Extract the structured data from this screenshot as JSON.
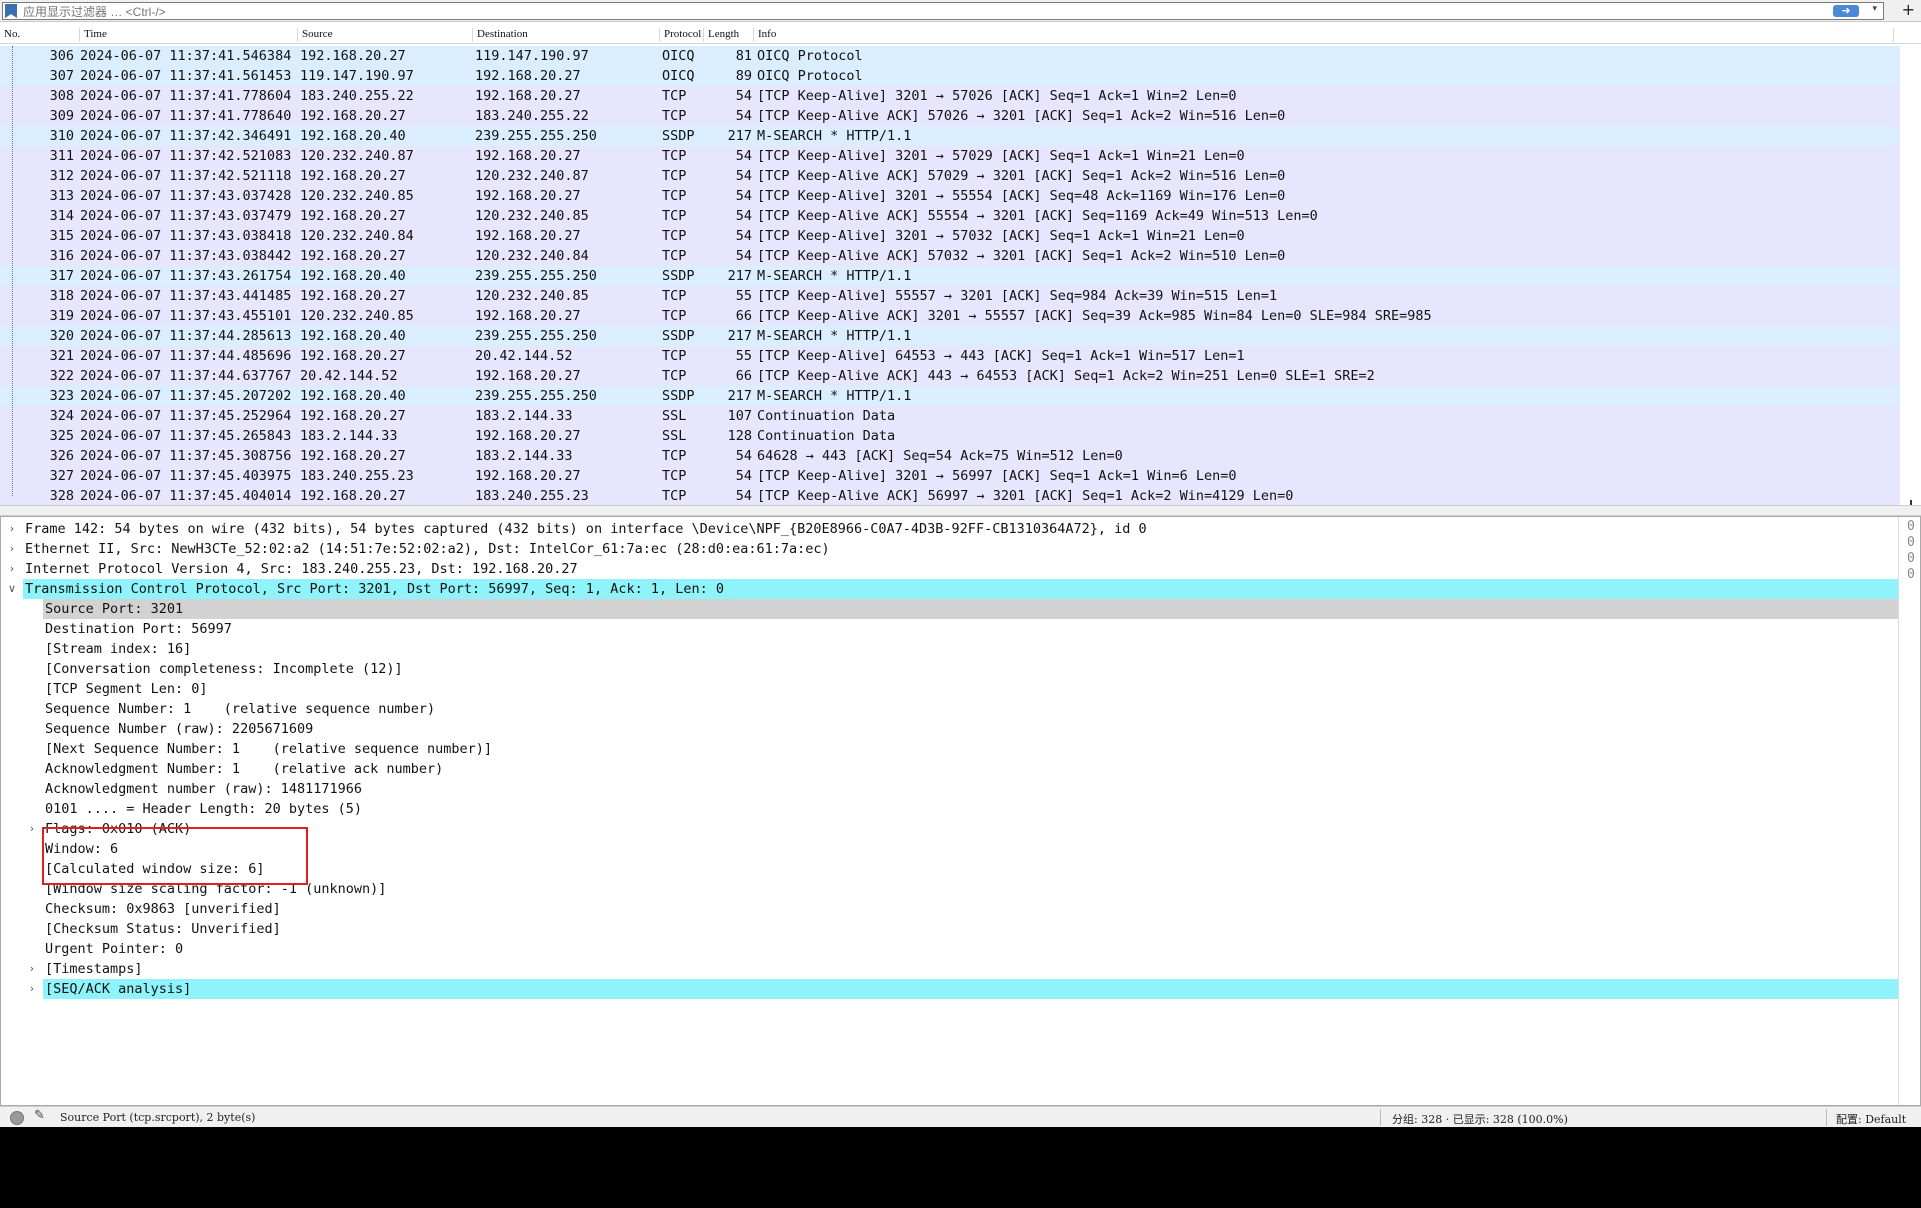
{
  "filter": {
    "placeholder": "应用显示过滤器 … <Ctrl-/>",
    "icons": {
      "bookmark": "bookmark-icon",
      "apply": "arrow-right-icon",
      "dropdown": "chevron-down-icon",
      "add": "plus-icon"
    }
  },
  "packet_list": {
    "columns": [
      "No.",
      "Time",
      "Source",
      "Destination",
      "Protocol",
      "Length",
      "Info"
    ],
    "rows": [
      {
        "no": "306",
        "time": "2024-06-07 11:37:41.546384",
        "src": "192.168.20.27",
        "dst": "119.147.190.97",
        "proto": "OICQ",
        "len": "81",
        "info": "OICQ Protocol"
      },
      {
        "no": "307",
        "time": "2024-06-07 11:37:41.561453",
        "src": "119.147.190.97",
        "dst": "192.168.20.27",
        "proto": "OICQ",
        "len": "89",
        "info": "OICQ Protocol"
      },
      {
        "no": "308",
        "time": "2024-06-07 11:37:41.778604",
        "src": "183.240.255.22",
        "dst": "192.168.20.27",
        "proto": "TCP",
        "len": "54",
        "info": "[TCP Keep-Alive] 3201 → 57026 [ACK] Seq=1 Ack=1 Win=2 Len=0"
      },
      {
        "no": "309",
        "time": "2024-06-07 11:37:41.778640",
        "src": "192.168.20.27",
        "dst": "183.240.255.22",
        "proto": "TCP",
        "len": "54",
        "info": "[TCP Keep-Alive ACK] 57026 → 3201 [ACK] Seq=1 Ack=2 Win=516 Len=0"
      },
      {
        "no": "310",
        "time": "2024-06-07 11:37:42.346491",
        "src": "192.168.20.40",
        "dst": "239.255.255.250",
        "proto": "SSDP",
        "len": "217",
        "info": "M-SEARCH * HTTP/1.1"
      },
      {
        "no": "311",
        "time": "2024-06-07 11:37:42.521083",
        "src": "120.232.240.87",
        "dst": "192.168.20.27",
        "proto": "TCP",
        "len": "54",
        "info": "[TCP Keep-Alive] 3201 → 57029 [ACK] Seq=1 Ack=1 Win=21 Len=0"
      },
      {
        "no": "312",
        "time": "2024-06-07 11:37:42.521118",
        "src": "192.168.20.27",
        "dst": "120.232.240.87",
        "proto": "TCP",
        "len": "54",
        "info": "[TCP Keep-Alive ACK] 57029 → 3201 [ACK] Seq=1 Ack=2 Win=516 Len=0"
      },
      {
        "no": "313",
        "time": "2024-06-07 11:37:43.037428",
        "src": "120.232.240.85",
        "dst": "192.168.20.27",
        "proto": "TCP",
        "len": "54",
        "info": "[TCP Keep-Alive] 3201 → 55554 [ACK] Seq=48 Ack=1169 Win=176 Len=0"
      },
      {
        "no": "314",
        "time": "2024-06-07 11:37:43.037479",
        "src": "192.168.20.27",
        "dst": "120.232.240.85",
        "proto": "TCP",
        "len": "54",
        "info": "[TCP Keep-Alive ACK] 55554 → 3201 [ACK] Seq=1169 Ack=49 Win=513 Len=0"
      },
      {
        "no": "315",
        "time": "2024-06-07 11:37:43.038418",
        "src": "120.232.240.84",
        "dst": "192.168.20.27",
        "proto": "TCP",
        "len": "54",
        "info": "[TCP Keep-Alive] 3201 → 57032 [ACK] Seq=1 Ack=1 Win=21 Len=0"
      },
      {
        "no": "316",
        "time": "2024-06-07 11:37:43.038442",
        "src": "192.168.20.27",
        "dst": "120.232.240.84",
        "proto": "TCP",
        "len": "54",
        "info": "[TCP Keep-Alive ACK] 57032 → 3201 [ACK] Seq=1 Ack=2 Win=510 Len=0"
      },
      {
        "no": "317",
        "time": "2024-06-07 11:37:43.261754",
        "src": "192.168.20.40",
        "dst": "239.255.255.250",
        "proto": "SSDP",
        "len": "217",
        "info": "M-SEARCH * HTTP/1.1"
      },
      {
        "no": "318",
        "time": "2024-06-07 11:37:43.441485",
        "src": "192.168.20.27",
        "dst": "120.232.240.85",
        "proto": "TCP",
        "len": "55",
        "info": "[TCP Keep-Alive] 55557 → 3201 [ACK] Seq=984 Ack=39 Win=515 Len=1"
      },
      {
        "no": "319",
        "time": "2024-06-07 11:37:43.455101",
        "src": "120.232.240.85",
        "dst": "192.168.20.27",
        "proto": "TCP",
        "len": "66",
        "info": "[TCP Keep-Alive ACK] 3201 → 55557 [ACK] Seq=39 Ack=985 Win=84 Len=0 SLE=984 SRE=985"
      },
      {
        "no": "320",
        "time": "2024-06-07 11:37:44.285613",
        "src": "192.168.20.40",
        "dst": "239.255.255.250",
        "proto": "SSDP",
        "len": "217",
        "info": "M-SEARCH * HTTP/1.1"
      },
      {
        "no": "321",
        "time": "2024-06-07 11:37:44.485696",
        "src": "192.168.20.27",
        "dst": "20.42.144.52",
        "proto": "TCP",
        "len": "55",
        "info": "[TCP Keep-Alive] 64553 → 443 [ACK] Seq=1 Ack=1 Win=517 Len=1"
      },
      {
        "no": "322",
        "time": "2024-06-07 11:37:44.637767",
        "src": "20.42.144.52",
        "dst": "192.168.20.27",
        "proto": "TCP",
        "len": "66",
        "info": "[TCP Keep-Alive ACK] 443 → 64553 [ACK] Seq=1 Ack=2 Win=251 Len=0 SLE=1 SRE=2"
      },
      {
        "no": "323",
        "time": "2024-06-07 11:37:45.207202",
        "src": "192.168.20.40",
        "dst": "239.255.255.250",
        "proto": "SSDP",
        "len": "217",
        "info": "M-SEARCH * HTTP/1.1"
      },
      {
        "no": "324",
        "time": "2024-06-07 11:37:45.252964",
        "src": "192.168.20.27",
        "dst": "183.2.144.33",
        "proto": "SSL",
        "len": "107",
        "info": "Continuation Data"
      },
      {
        "no": "325",
        "time": "2024-06-07 11:37:45.265843",
        "src": "183.2.144.33",
        "dst": "192.168.20.27",
        "proto": "SSL",
        "len": "128",
        "info": "Continuation Data"
      },
      {
        "no": "326",
        "time": "2024-06-07 11:37:45.308756",
        "src": "192.168.20.27",
        "dst": "183.2.144.33",
        "proto": "TCP",
        "len": "54",
        "info": "64628 → 443 [ACK] Seq=54 Ack=75 Win=512 Len=0"
      },
      {
        "no": "327",
        "time": "2024-06-07 11:37:45.403975",
        "src": "183.240.255.23",
        "dst": "192.168.20.27",
        "proto": "TCP",
        "len": "54",
        "info": "[TCP Keep-Alive] 3201 → 56997 [ACK] Seq=1 Ack=1 Win=6 Len=0"
      },
      {
        "no": "328",
        "time": "2024-06-07 11:37:45.404014",
        "src": "192.168.20.27",
        "dst": "183.240.255.23",
        "proto": "TCP",
        "len": "54",
        "info": "[TCP Keep-Alive ACK] 56997 → 3201 [ACK] Seq=1 Ack=2 Win=4129 Len=0"
      }
    ]
  },
  "detail_tree": [
    {
      "text": "Frame 142: 54 bytes on wire (432 bits), 54 bytes captured (432 bits) on interface \\Device\\NPF_{B20E8966-C0A7-4D3B-92FF-CB1310364A72}, id 0",
      "level": 0,
      "arrow": "collapsed"
    },
    {
      "text": "Ethernet II, Src: NewH3CTe_52:02:a2 (14:51:7e:52:02:a2), Dst: IntelCor_61:7a:ec (28:d0:ea:61:7a:ec)",
      "level": 0,
      "arrow": "collapsed"
    },
    {
      "text": "Internet Protocol Version 4, Src: 183.240.255.23, Dst: 192.168.20.27",
      "level": 0,
      "arrow": "collapsed"
    },
    {
      "text": "Transmission Control Protocol, Src Port: 3201, Dst Port: 56997, Seq: 1, Ack: 1, Len: 0",
      "level": 0,
      "arrow": "expanded",
      "highlight": "cyan"
    },
    {
      "text": "Source Port: 3201",
      "level": 1,
      "arrow": "none",
      "highlight": "gray"
    },
    {
      "text": "Destination Port: 56997",
      "level": 1,
      "arrow": "none"
    },
    {
      "text": "[Stream index: 16]",
      "level": 1,
      "arrow": "none"
    },
    {
      "text": "[Conversation completeness: Incomplete (12)]",
      "level": 1,
      "arrow": "none"
    },
    {
      "text": "[TCP Segment Len: 0]",
      "level": 1,
      "arrow": "none"
    },
    {
      "text": "Sequence Number: 1    (relative sequence number)",
      "level": 1,
      "arrow": "none"
    },
    {
      "text": "Sequence Number (raw): 2205671609",
      "level": 1,
      "arrow": "none"
    },
    {
      "text": "[Next Sequence Number: 1    (relative sequence number)]",
      "level": 1,
      "arrow": "none"
    },
    {
      "text": "Acknowledgment Number: 1    (relative ack number)",
      "level": 1,
      "arrow": "none"
    },
    {
      "text": "Acknowledgment number (raw): 1481171966",
      "level": 1,
      "arrow": "none"
    },
    {
      "text": "0101 .... = Header Length: 20 bytes (5)",
      "level": 1,
      "arrow": "none"
    },
    {
      "text": "Flags: 0x010 (ACK)",
      "level": 1,
      "arrow": "collapsed"
    },
    {
      "text": "Window: 6",
      "level": 1,
      "arrow": "none"
    },
    {
      "text": "[Calculated window size: 6]",
      "level": 1,
      "arrow": "none"
    },
    {
      "text": "[Window size scaling factor: -1 (unknown)]",
      "level": 1,
      "arrow": "none"
    },
    {
      "text": "Checksum: 0x9863 [unverified]",
      "level": 1,
      "arrow": "none"
    },
    {
      "text": "[Checksum Status: Unverified]",
      "level": 1,
      "arrow": "none"
    },
    {
      "text": "Urgent Pointer: 0",
      "level": 1,
      "arrow": "none"
    },
    {
      "text": "[Timestamps]",
      "level": 1,
      "arrow": "collapsed"
    },
    {
      "text": "[SEQ/ACK analysis]",
      "level": 1,
      "arrow": "collapsed",
      "highlight": "cyan"
    }
  ],
  "hex_fragments": [
    "0",
    "0",
    "0",
    "0"
  ],
  "statusbar": {
    "field": "Source Port (tcp.srcport), 2 byte(s)",
    "packets": "分组: 328 · 已显示: 328 (100.0%)",
    "profile": "配置: Default"
  },
  "colors": {
    "row_tcp": "#e7e6ff",
    "row_udp": "#daeeff",
    "row_selected_detail": "#8ef3fb",
    "row_gray": "#d2d2d2",
    "highlight_box": "#e02020"
  }
}
